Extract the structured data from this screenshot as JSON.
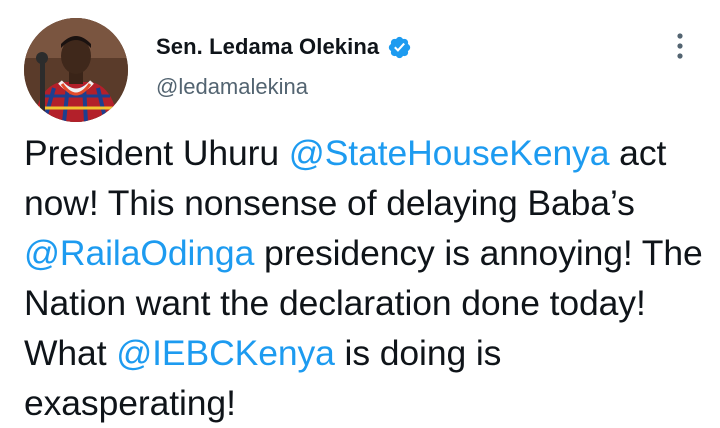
{
  "author": {
    "display_name": "Sen. Ledama Olekina",
    "handle": "@ledamalekina",
    "verified": true
  },
  "tweet": {
    "segments": [
      {
        "text": "President Uhuru ",
        "type": "text"
      },
      {
        "text": "@StateHouseKenya",
        "type": "mention"
      },
      {
        "text": " act now! This nonsense of delaying Baba’s ",
        "type": "text"
      },
      {
        "text": "@RailaOdinga",
        "type": "mention"
      },
      {
        "text": " presidency is annoying! The Nation want the declaration done today! What ",
        "type": "text"
      },
      {
        "text": "@IEBCKenya",
        "type": "mention"
      },
      {
        "text": " is doing is exasperating!",
        "type": "text"
      }
    ]
  },
  "icons": {
    "verified": "verified-badge-icon",
    "more": "more-options-icon"
  },
  "colors": {
    "text": "#0f1419",
    "secondary": "#536471",
    "accent": "#1d9bf0"
  }
}
